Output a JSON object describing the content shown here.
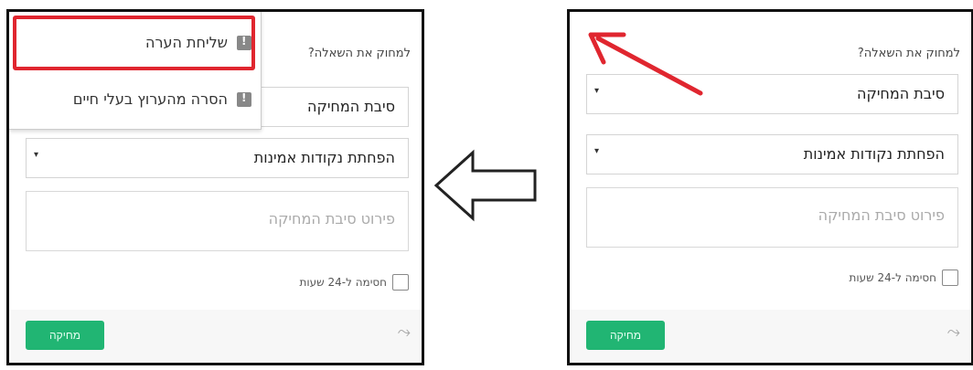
{
  "form": {
    "title": "למחוק את השאלה?",
    "reason_select": "סיבת המחיקה",
    "points_select": "הפחתת נקודות אמינות",
    "details_placeholder": "פירוט סיבת המחיקה",
    "block_label": "חסימה ל-24 שעות",
    "delete_button": "מחיקה"
  },
  "menu": {
    "items": [
      {
        "label": "שליחת הערה"
      },
      {
        "label": "הסרה מהערוץ בעלי חיים"
      }
    ]
  },
  "colors": {
    "accent_green": "#21b573",
    "highlight_red": "#e0262f",
    "panel_border": "#111111"
  },
  "icons": {
    "menu_item_icon": "flag-icon",
    "reply": "reply-icon",
    "dropdown": "chevron-down-icon",
    "direction_arrow": "arrow-left-icon",
    "pointer_arrow": "arrow-up-left-icon"
  }
}
